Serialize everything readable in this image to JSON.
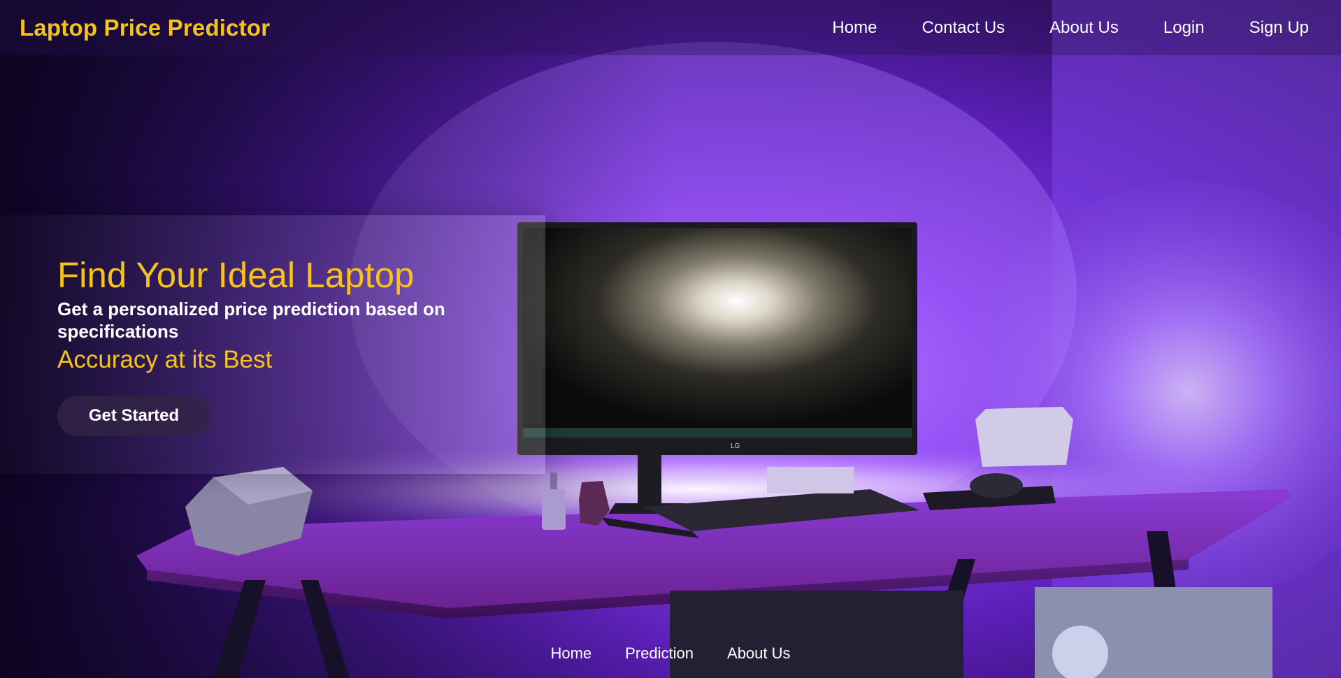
{
  "brand": "Laptop Price Predictor",
  "nav": {
    "items": [
      {
        "label": "Home"
      },
      {
        "label": "Contact Us"
      },
      {
        "label": "About Us"
      },
      {
        "label": "Login"
      },
      {
        "label": "Sign Up"
      }
    ]
  },
  "hero": {
    "title": "Find Your Ideal Laptop",
    "subtitle": "Get a personalized price prediction based on specifications",
    "tagline": "Accuracy at its Best",
    "cta_label": "Get Started"
  },
  "footer": {
    "items": [
      {
        "label": "Home"
      },
      {
        "label": "Prediction"
      },
      {
        "label": "About Us"
      }
    ]
  },
  "colors": {
    "accent": "#f6c31a",
    "text": "#ffffff",
    "background": "#2a0c5c",
    "glow": "#8a3cf0"
  }
}
